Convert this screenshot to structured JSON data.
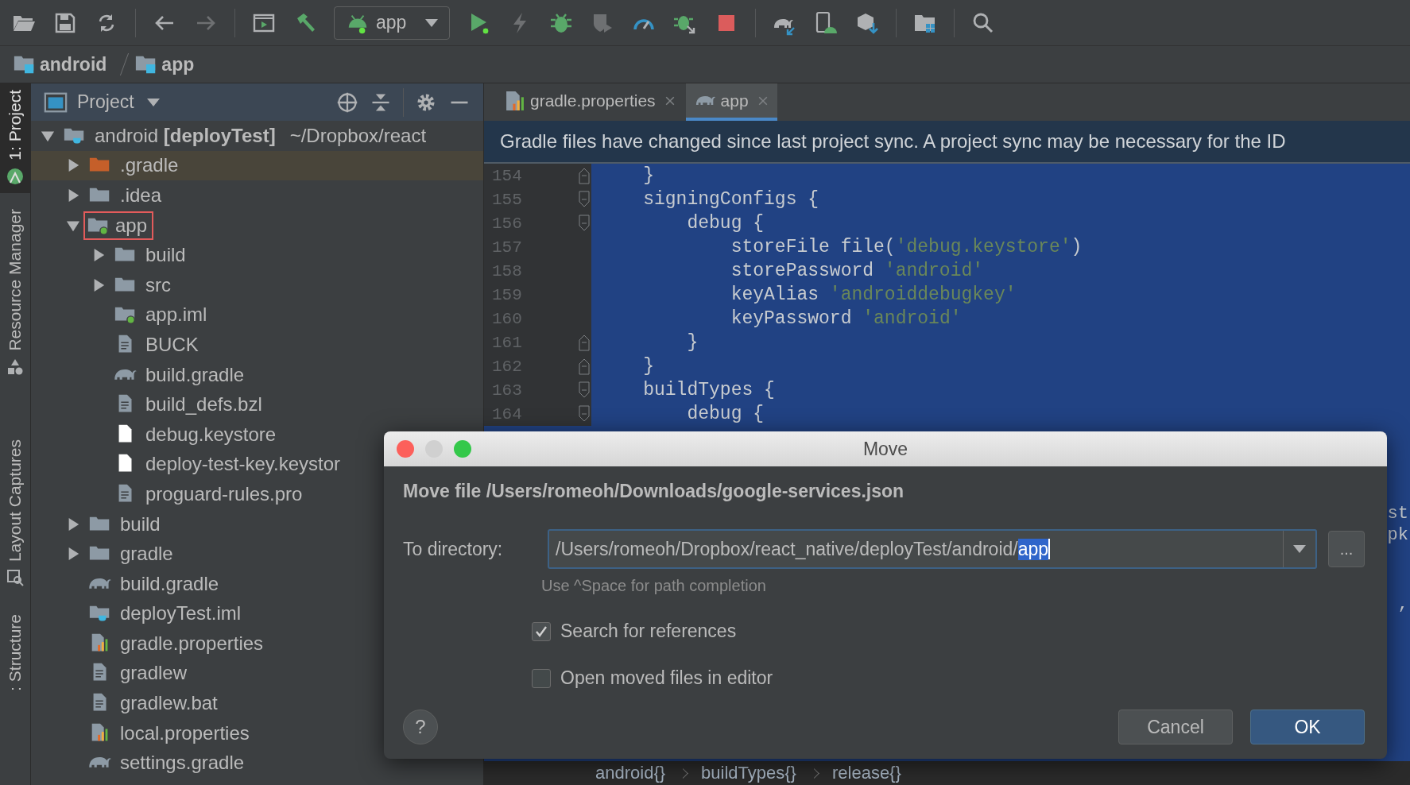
{
  "toolbar": {
    "run_configuration": "app"
  },
  "breadcrumb": [
    "android",
    "app"
  ],
  "side_tabs": [
    {
      "label": "1: Project",
      "selected": true
    },
    {
      "label": "Resource Manager",
      "selected": false
    },
    {
      "label": "Layout Captures",
      "selected": false
    },
    {
      "label": ": Structure",
      "selected": false
    }
  ],
  "project_panel": {
    "title": "Project",
    "tree": [
      {
        "label": "android **[deployTest]**",
        "path": "~/Dropbox/react",
        "kind": "module",
        "expanded": true,
        "children": [
          {
            "label": ".gradle",
            "kind": "excluded",
            "expanded": false
          },
          {
            "label": ".idea",
            "kind": "folder",
            "expanded": false
          },
          {
            "label": "app",
            "kind": "module_folder",
            "expanded": true,
            "outlined": true,
            "children": [
              {
                "label": "build",
                "kind": "folder",
                "expanded": false
              },
              {
                "label": "src",
                "kind": "folder",
                "expanded": false
              },
              {
                "label": "app.iml",
                "kind": "module_folder"
              },
              {
                "label": "BUCK",
                "kind": "text"
              },
              {
                "label": "build.gradle",
                "kind": "gradle"
              },
              {
                "label": "build_defs.bzl",
                "kind": "text"
              },
              {
                "label": "debug.keystore",
                "kind": "blank"
              },
              {
                "label": "deploy-test-key.keystor",
                "kind": "blank"
              },
              {
                "label": "proguard-rules.pro",
                "kind": "text"
              }
            ]
          },
          {
            "label": "build",
            "kind": "folder",
            "expanded": false
          },
          {
            "label": "gradle",
            "kind": "folder",
            "expanded": false
          },
          {
            "label": "build.gradle",
            "kind": "gradle"
          },
          {
            "label": "deployTest.iml",
            "kind": "module"
          },
          {
            "label": "gradle.properties",
            "kind": "properties"
          },
          {
            "label": "gradlew",
            "kind": "text"
          },
          {
            "label": "gradlew.bat",
            "kind": "text"
          },
          {
            "label": "local.properties",
            "kind": "properties"
          },
          {
            "label": "settings.gradle",
            "kind": "gradle"
          }
        ]
      }
    ]
  },
  "editor": {
    "tabs": [
      {
        "label": "gradle.properties",
        "kind": "properties",
        "selected": false
      },
      {
        "label": "app",
        "kind": "gradle",
        "selected": true
      }
    ],
    "banner": "Gradle files have changed since last project sync. A project sync may be necessary for the ID",
    "lines": [
      {
        "number": "154",
        "kind": "fold_end",
        "segments": [
          {
            "text": "    }"
          }
        ]
      },
      {
        "number": "155",
        "kind": "fold_start",
        "segments": [
          {
            "text": "    signingConfigs {"
          }
        ]
      },
      {
        "number": "156",
        "kind": "fold_start",
        "segments": [
          {
            "text": "        debug {"
          }
        ]
      },
      {
        "number": "157",
        "segments": [
          {
            "text": "            storeFile file("
          },
          {
            "text": "'debug.keystore'",
            "kind": "string"
          },
          {
            "text": ")"
          }
        ]
      },
      {
        "number": "158",
        "segments": [
          {
            "text": "            storePassword "
          },
          {
            "text": "'android'",
            "kind": "string"
          }
        ]
      },
      {
        "number": "159",
        "segments": [
          {
            "text": "            keyAlias "
          },
          {
            "text": "'androiddebugkey'",
            "kind": "string"
          }
        ]
      },
      {
        "number": "160",
        "segments": [
          {
            "text": "            keyPassword "
          },
          {
            "text": "'android'",
            "kind": "string"
          }
        ]
      },
      {
        "number": "161",
        "kind": "fold_end",
        "segments": [
          {
            "text": "        }"
          }
        ]
      },
      {
        "number": "162",
        "kind": "fold_end",
        "segments": [
          {
            "text": "    }"
          }
        ]
      },
      {
        "number": "163",
        "kind": "fold_start",
        "segments": [
          {
            "text": "    buildTypes {"
          }
        ]
      },
      {
        "number": "164",
        "kind": "fold_start",
        "segments": [
          {
            "text": "        debug {"
          }
        ]
      }
    ],
    "right_fragments": [
      {
        "text": "st"
      },
      {
        "text": "pk"
      },
      {
        "text": ","
      }
    ],
    "breadcrumb": [
      "android{}",
      "buildTypes{}",
      "release{}"
    ]
  },
  "dialog": {
    "title": "Move",
    "heading": "Move file /Users/romeoh/Downloads/google-services.json",
    "field_label": "To directory:",
    "value": "/Users/romeoh/Dropbox/react_native/deployTest/android/",
    "selected_text": "app",
    "browse": "...",
    "hint": "Use ^Space for path completion",
    "checkboxes": [
      {
        "label": "Search for references",
        "checked": true
      },
      {
        "label": "Open moved files in editor",
        "checked": false
      }
    ],
    "help": "?",
    "buttons": [
      {
        "label": "Cancel",
        "default": false
      },
      {
        "label": "OK",
        "default": true
      }
    ]
  }
}
